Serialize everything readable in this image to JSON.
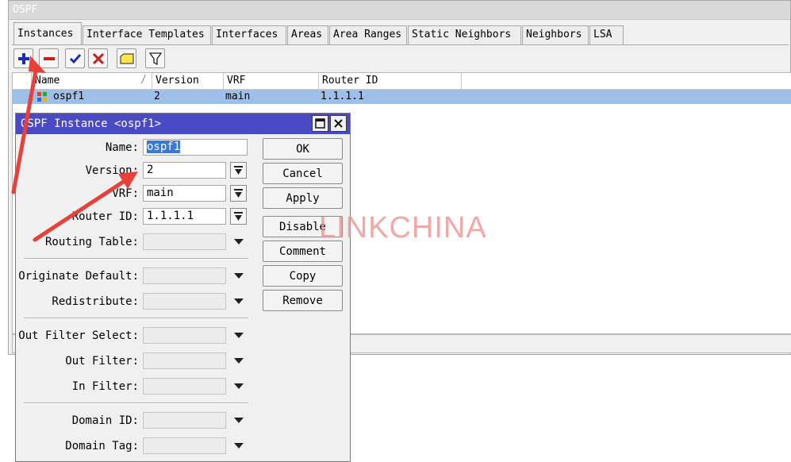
{
  "window": {
    "title": "OSPF"
  },
  "tabs": [
    {
      "label": "Instances",
      "active": true
    },
    {
      "label": "Interface Templates"
    },
    {
      "label": "Interfaces"
    },
    {
      "label": "Areas"
    },
    {
      "label": "Area Ranges"
    },
    {
      "label": "Static Neighbors"
    },
    {
      "label": "Neighbors"
    },
    {
      "label": "LSA"
    }
  ],
  "toolbar": [
    "add-icon",
    "remove-icon",
    "enable-check-icon",
    "disable-x-icon",
    "comment-note-icon",
    "filter-funnel-icon"
  ],
  "table": {
    "columns": [
      "Name",
      "Version",
      "VRF",
      "Router ID"
    ],
    "sort_indicator": "/",
    "rows": [
      {
        "name": "ospf1",
        "version": "2",
        "vrf": "main",
        "router_id": "1.1.1.1",
        "selected": true
      }
    ]
  },
  "dialog": {
    "title": "OSPF Instance <ospf1>",
    "fields": {
      "name": {
        "label": "Name:",
        "value": "ospf1"
      },
      "version": {
        "label": "Version:",
        "value": "2"
      },
      "vrf": {
        "label": "VRF:",
        "value": "main"
      },
      "router_id": {
        "label": "Router ID:",
        "value": "1.1.1.1"
      },
      "routing_table": {
        "label": "Routing Table:",
        "value": ""
      },
      "originate_default": {
        "label": "Originate Default:",
        "value": ""
      },
      "redistribute": {
        "label": "Redistribute:",
        "value": ""
      },
      "out_filter_select": {
        "label": "Out Filter Select:",
        "value": ""
      },
      "out_filter": {
        "label": "Out Filter:",
        "value": ""
      },
      "in_filter": {
        "label": "In Filter:",
        "value": ""
      },
      "domain_id": {
        "label": "Domain ID:",
        "value": ""
      },
      "domain_tag": {
        "label": "Domain Tag:",
        "value": ""
      }
    },
    "buttons": {
      "ok": "OK",
      "cancel": "Cancel",
      "apply": "Apply",
      "disable": "Disable",
      "comment": "Comment",
      "copy": "Copy",
      "remove": "Remove"
    }
  },
  "watermark": "LINKCHINA",
  "colors": {
    "dialog_titlebar": "#4a4ac4",
    "selected_row": "#9ec0e8",
    "annotation_arrow": "#e8413c",
    "watermark": "#f08a8a"
  }
}
